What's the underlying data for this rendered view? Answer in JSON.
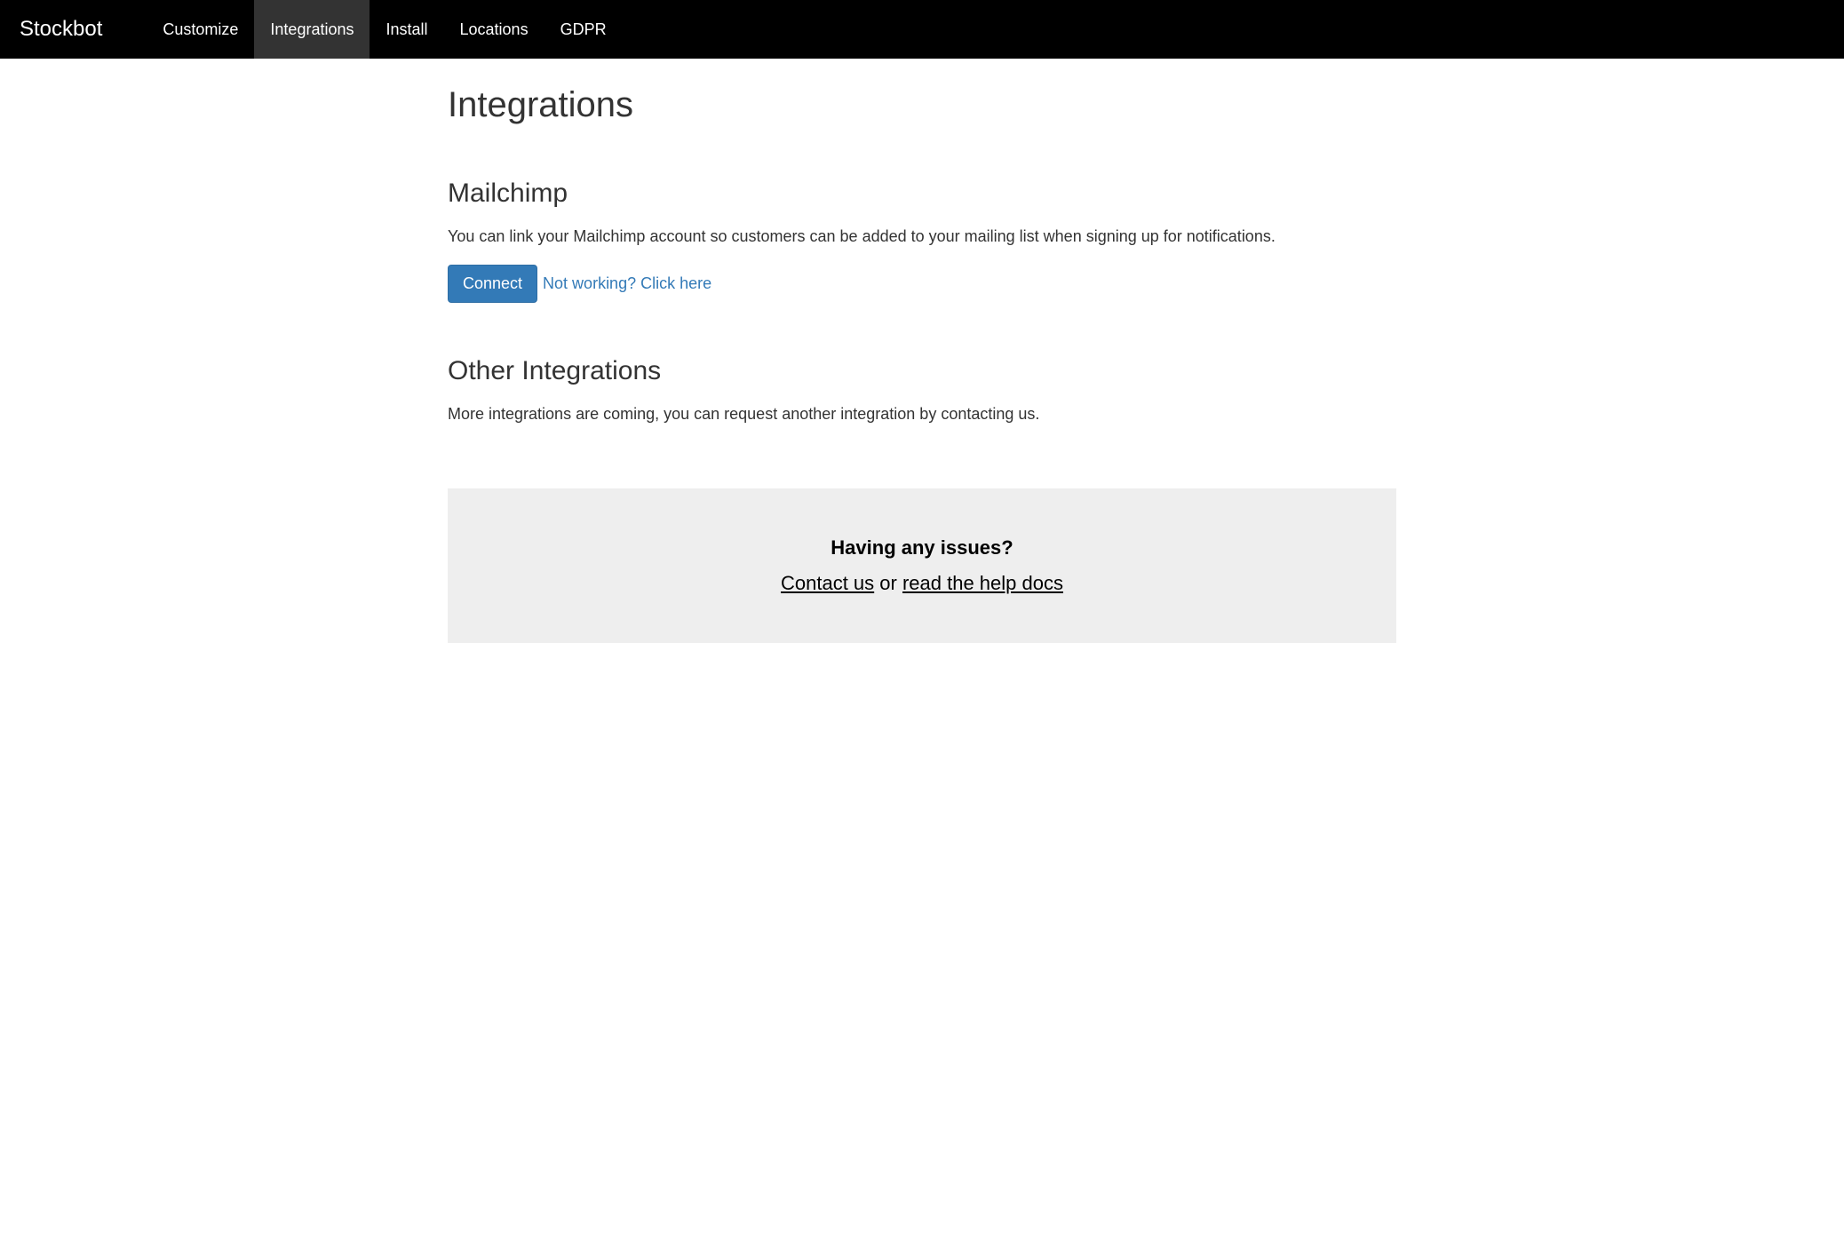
{
  "brand": "Stockbot",
  "nav": {
    "items": [
      {
        "label": "Customize",
        "active": false
      },
      {
        "label": "Integrations",
        "active": true
      },
      {
        "label": "Install",
        "active": false
      },
      {
        "label": "Locations",
        "active": false
      },
      {
        "label": "GDPR",
        "active": false
      }
    ]
  },
  "page": {
    "title": "Integrations"
  },
  "mailchimp": {
    "title": "Mailchimp",
    "description": "You can link your Mailchimp account so customers can be added to your mailing list when signing up for notifications.",
    "connect_label": "Connect",
    "not_working_label": "Not working? Click here"
  },
  "other": {
    "title": "Other Integrations",
    "description": "More integrations are coming, you can request another integration by contacting us."
  },
  "help": {
    "title": "Having any issues?",
    "contact_label": "Contact us",
    "or_text": " or ",
    "docs_label": "read the help docs"
  }
}
